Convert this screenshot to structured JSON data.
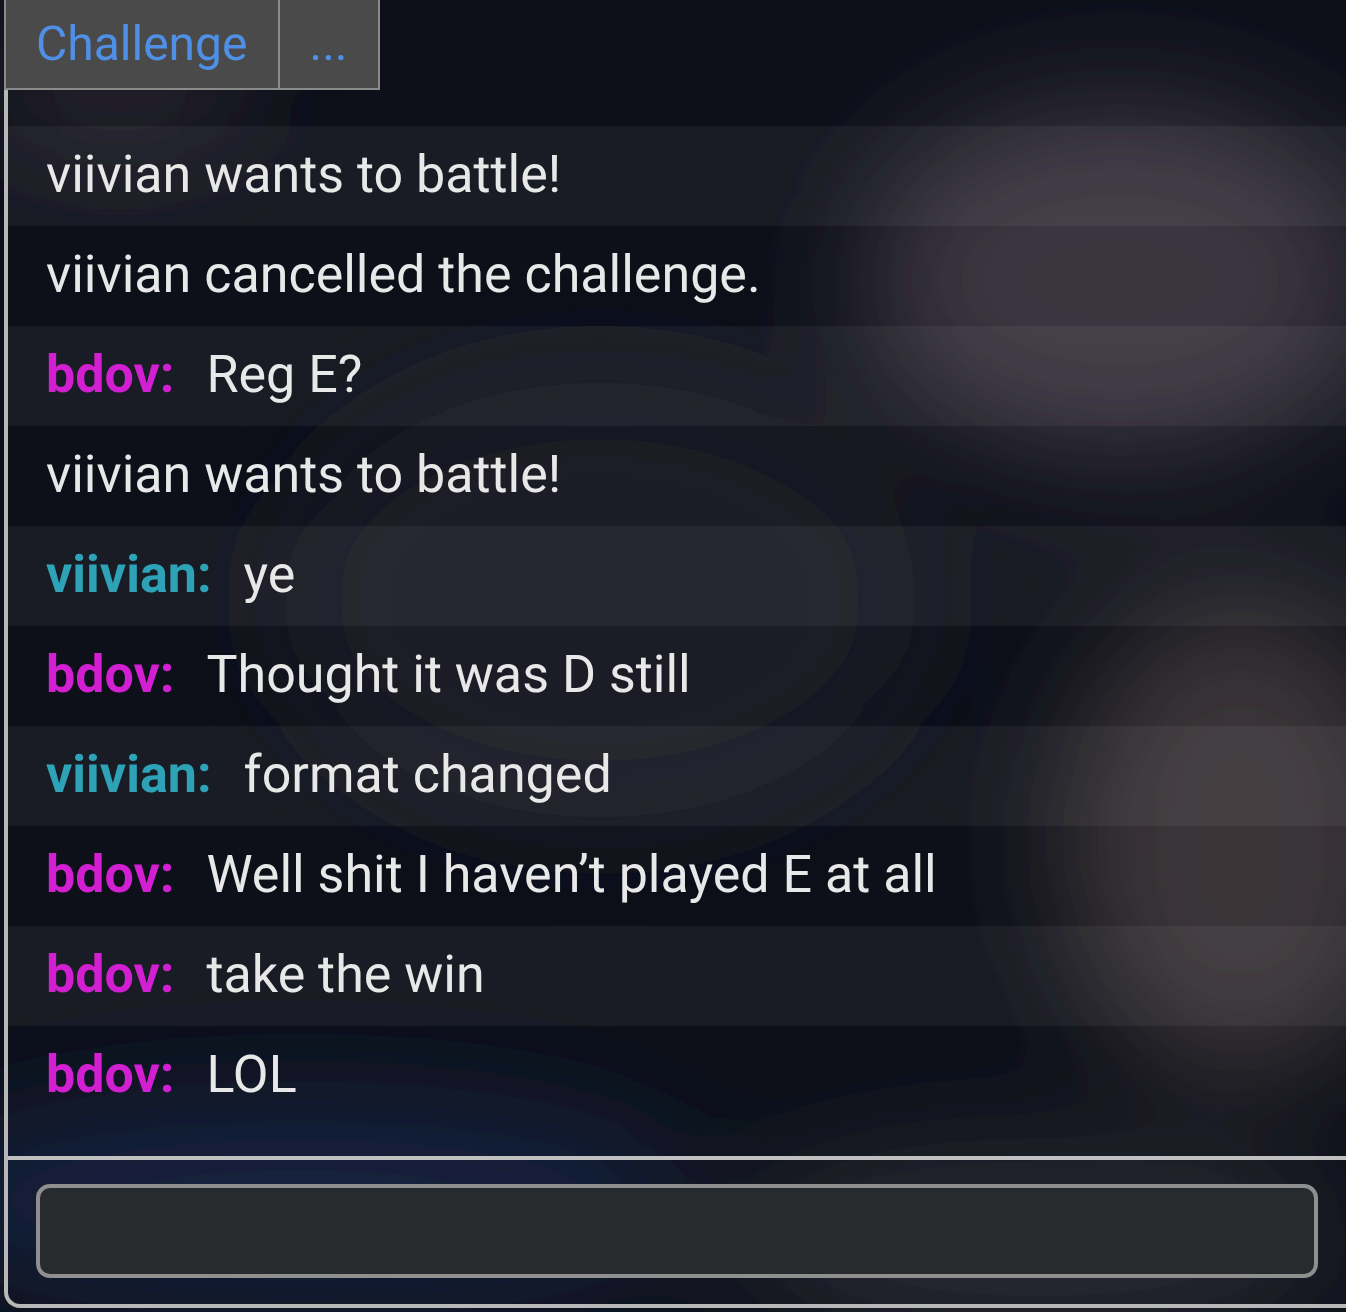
{
  "tabs": [
    {
      "label": "Challenge"
    },
    {
      "label": "..."
    }
  ],
  "messages": [
    {
      "kind": "system",
      "text": "viivian wants to battle!"
    },
    {
      "kind": "system",
      "text": "viivian cancelled the challenge."
    },
    {
      "kind": "chat",
      "user": "bdov:",
      "color": "#d21fd2",
      "text": "Reg E?"
    },
    {
      "kind": "system",
      "text": "viivian wants to battle!"
    },
    {
      "kind": "chat",
      "user": "viivian:",
      "color": "#2ea3b8",
      "text": "ye"
    },
    {
      "kind": "chat",
      "user": "bdov:",
      "color": "#d21fd2",
      "text": "Thought it was D still"
    },
    {
      "kind": "chat",
      "user": "viivian:",
      "color": "#2ea3b8",
      "text": "format changed"
    },
    {
      "kind": "chat",
      "user": "bdov:",
      "color": "#d21fd2",
      "text": "Well shit I haven’t played E at all"
    },
    {
      "kind": "chat",
      "user": "bdov:",
      "color": "#d21fd2",
      "text": "take the win"
    },
    {
      "kind": "chat",
      "user": "bdov:",
      "color": "#d21fd2",
      "text": "LOL"
    }
  ]
}
